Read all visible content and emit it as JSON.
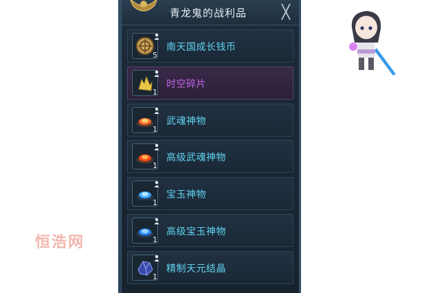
{
  "window": {
    "title": "青龙鬼的战利品",
    "close_symbol": "╳"
  },
  "items": [
    {
      "name": "南天国成长钱币",
      "count": "5",
      "icon": "coin-icon",
      "rarity_color": "#5fd3f0"
    },
    {
      "name": "时空碎片",
      "count": "1",
      "icon": "crystal-shard-icon",
      "rarity_color": "#c464e8"
    },
    {
      "name": "武魂神物",
      "count": "1",
      "icon": "fire-bowl-icon",
      "rarity_color": "#5fd3f0"
    },
    {
      "name": "高级武魂神物",
      "count": "1",
      "icon": "fire-bowl-icon",
      "rarity_color": "#5fd3f0"
    },
    {
      "name": "宝玉神物",
      "count": "1",
      "icon": "frost-bowl-icon",
      "rarity_color": "#5fd3f0"
    },
    {
      "name": "高级宝玉神物",
      "count": "1",
      "icon": "frost-bowl-icon",
      "rarity_color": "#5fd3f0"
    },
    {
      "name": "精制天元结晶",
      "count": "1",
      "icon": "blue-crystal-icon",
      "rarity_color": "#5fd3f0"
    }
  ],
  "watermark": "恒浩网"
}
